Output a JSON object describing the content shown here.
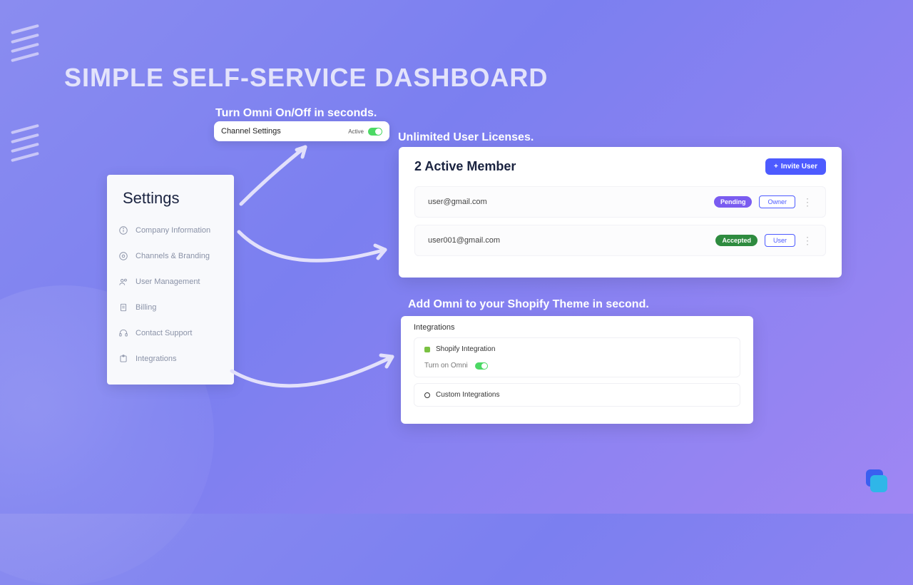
{
  "headline": "SIMPLE SELF-SERVICE DASHBOARD",
  "captions": {
    "toggle": "Turn Omni On/Off in seconds.",
    "licenses": "Unlimited User Licenses.",
    "shopify": "Add Omni to your Shopify Theme in second."
  },
  "settings": {
    "title": "Settings",
    "items": [
      {
        "label": "Company Information"
      },
      {
        "label": "Channels & Branding"
      },
      {
        "label": "User Management"
      },
      {
        "label": "Billing"
      },
      {
        "label": "Contact Support"
      },
      {
        "label": "Integrations"
      }
    ]
  },
  "channel": {
    "label": "Channel Settings",
    "status": "Active"
  },
  "members": {
    "title": "2 Active Member",
    "invite_label": "Invite User",
    "rows": [
      {
        "email": "user@gmail.com",
        "status": "Pending",
        "role": "Owner"
      },
      {
        "email": "user001@gmail.com",
        "status": "Accepted",
        "role": "User"
      }
    ]
  },
  "integrations": {
    "title": "Integrations",
    "shopify": "Shopify Integration",
    "turn_on": "Turn on Omni",
    "custom": "Custom Integrations"
  }
}
